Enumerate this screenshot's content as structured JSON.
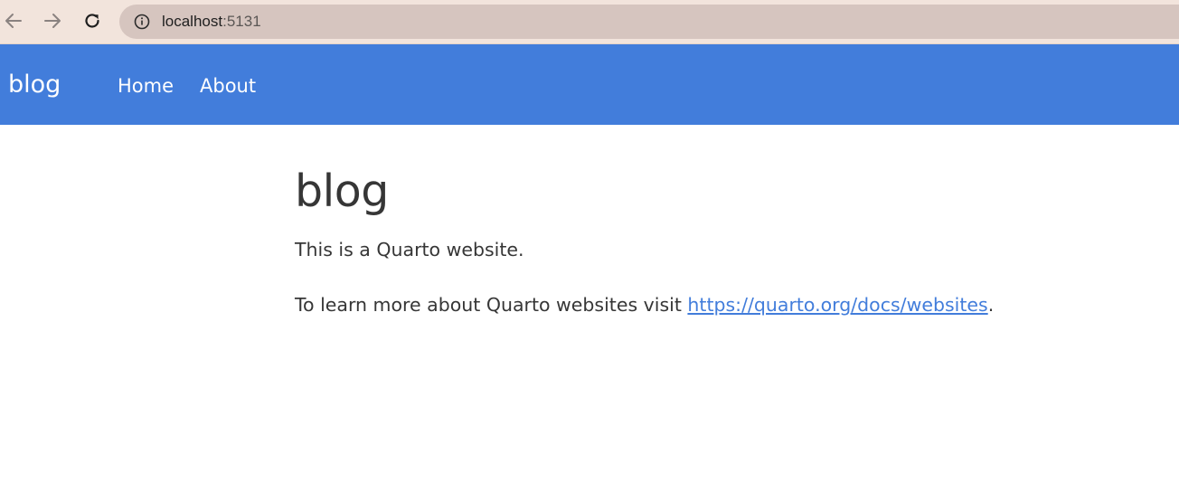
{
  "browser": {
    "back_icon": "arrow-left-icon",
    "forward_icon": "arrow-right-icon",
    "reload_icon": "reload-icon",
    "info_icon": "info-icon",
    "url_host": "localhost",
    "url_port": ":5131"
  },
  "navbar": {
    "brand": "blog",
    "links": [
      {
        "label": "Home"
      },
      {
        "label": "About"
      }
    ],
    "background": "#427ddb"
  },
  "main": {
    "title": "blog",
    "intro": "This is a Quarto website.",
    "learn_more_prefix": "To learn more about Quarto websites visit ",
    "learn_more_link": "https://quarto.org/docs/websites",
    "learn_more_suffix": "."
  }
}
